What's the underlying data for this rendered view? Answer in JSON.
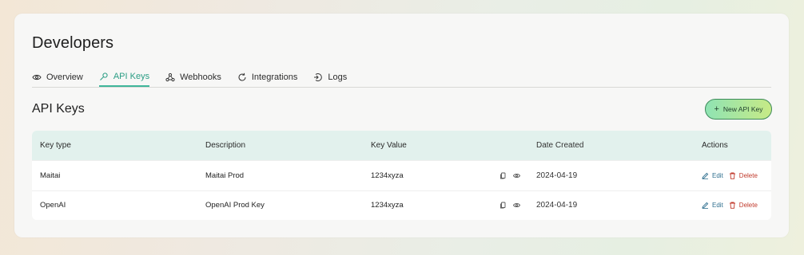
{
  "page": {
    "title": "Developers"
  },
  "tabs": [
    {
      "label": "Overview",
      "icon": "eye-icon",
      "active": false
    },
    {
      "label": "API Keys",
      "icon": "key-icon",
      "active": true
    },
    {
      "label": "Webhooks",
      "icon": "webhook-icon",
      "active": false
    },
    {
      "label": "Integrations",
      "icon": "refresh-icon",
      "active": false
    },
    {
      "label": "Logs",
      "icon": "logs-icon",
      "active": false
    }
  ],
  "section": {
    "title": "API Keys",
    "new_button_label": "New API Key"
  },
  "table": {
    "headers": [
      "Key type",
      "Description",
      "Key Value",
      "Date Created",
      "Actions"
    ],
    "rows": [
      {
        "key_type": "Maitai",
        "description": "Maitai Prod",
        "key_value": "1234xyza",
        "date_created": "2024-04-19",
        "edit_label": "Edit",
        "delete_label": "Delete"
      },
      {
        "key_type": "OpenAI",
        "description": "OpenAI Prod Key",
        "key_value": "1234xyza",
        "date_created": "2024-04-19",
        "edit_label": "Edit",
        "delete_label": "Delete"
      }
    ]
  },
  "colors": {
    "accent": "#3fb69a",
    "header_bg": "#e2f1ed",
    "delete": "#c0392b",
    "edit": "#2f6f8f"
  }
}
